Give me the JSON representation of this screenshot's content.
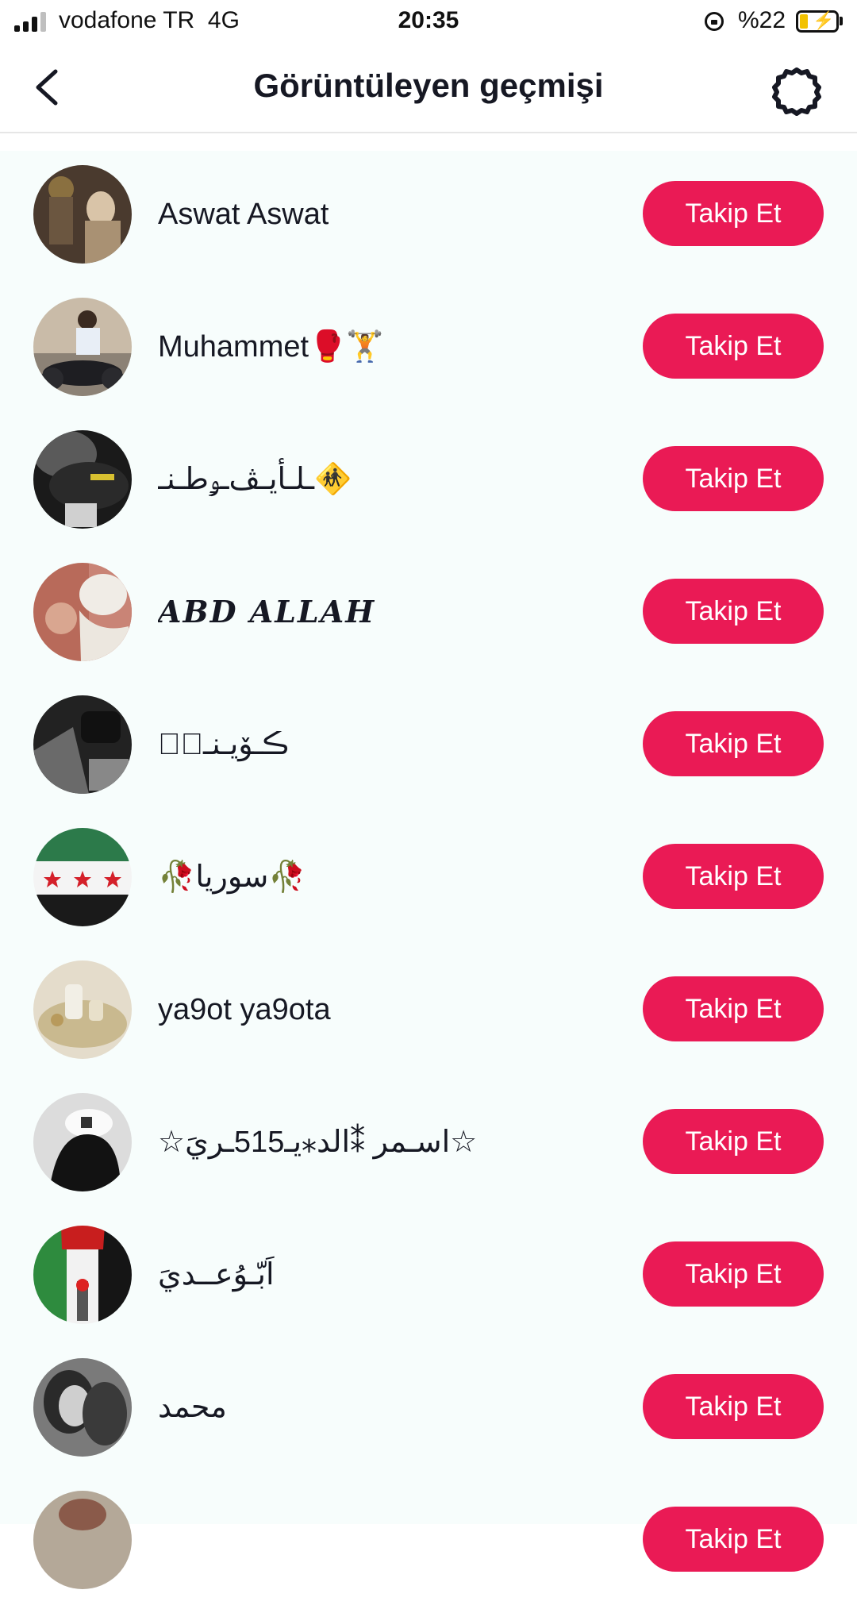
{
  "status_bar": {
    "carrier": "vodafone TR",
    "network": "4G",
    "time": "20:35",
    "battery": "%22",
    "battery_level": 0.22
  },
  "header": {
    "title": "Görüntüleyen geçmişi",
    "back_icon": "chevron-left-icon",
    "settings_icon": "gear-icon"
  },
  "colors": {
    "accent": "#ea1a55",
    "list_background": "#f7fdfc"
  },
  "viewers": [
    {
      "name": "Aswat Aswat",
      "button": "Takip Et"
    },
    {
      "name": "Muhammet🥊🏋",
      "button": "Takip Et"
    },
    {
      "name": "ـلـأيـﭫـﯡطـنـ🚸",
      "button": "Takip Et"
    },
    {
      "name": "𝑨𝑩𝑫 𝑨𝑳𝑳𝑨𝑯",
      "button": "Takip Et"
    },
    {
      "name": "ڪـۆيـنـيۧ",
      "button": "Takip Et"
    },
    {
      "name": "🥀سوريا🥀",
      "button": "Takip Et"
    },
    {
      "name": "ya9ot ya9ota",
      "button": "Takip Et"
    },
    {
      "name": "☆اسـمر ⁑الد⁎يـ515ـريَ☆",
      "button": "Takip Et"
    },
    {
      "name": "اَبّـوُعــديَ",
      "button": "Takip Et"
    },
    {
      "name": "محمد",
      "button": "Takip Et"
    },
    {
      "name": "",
      "button": "Takip Et"
    }
  ]
}
